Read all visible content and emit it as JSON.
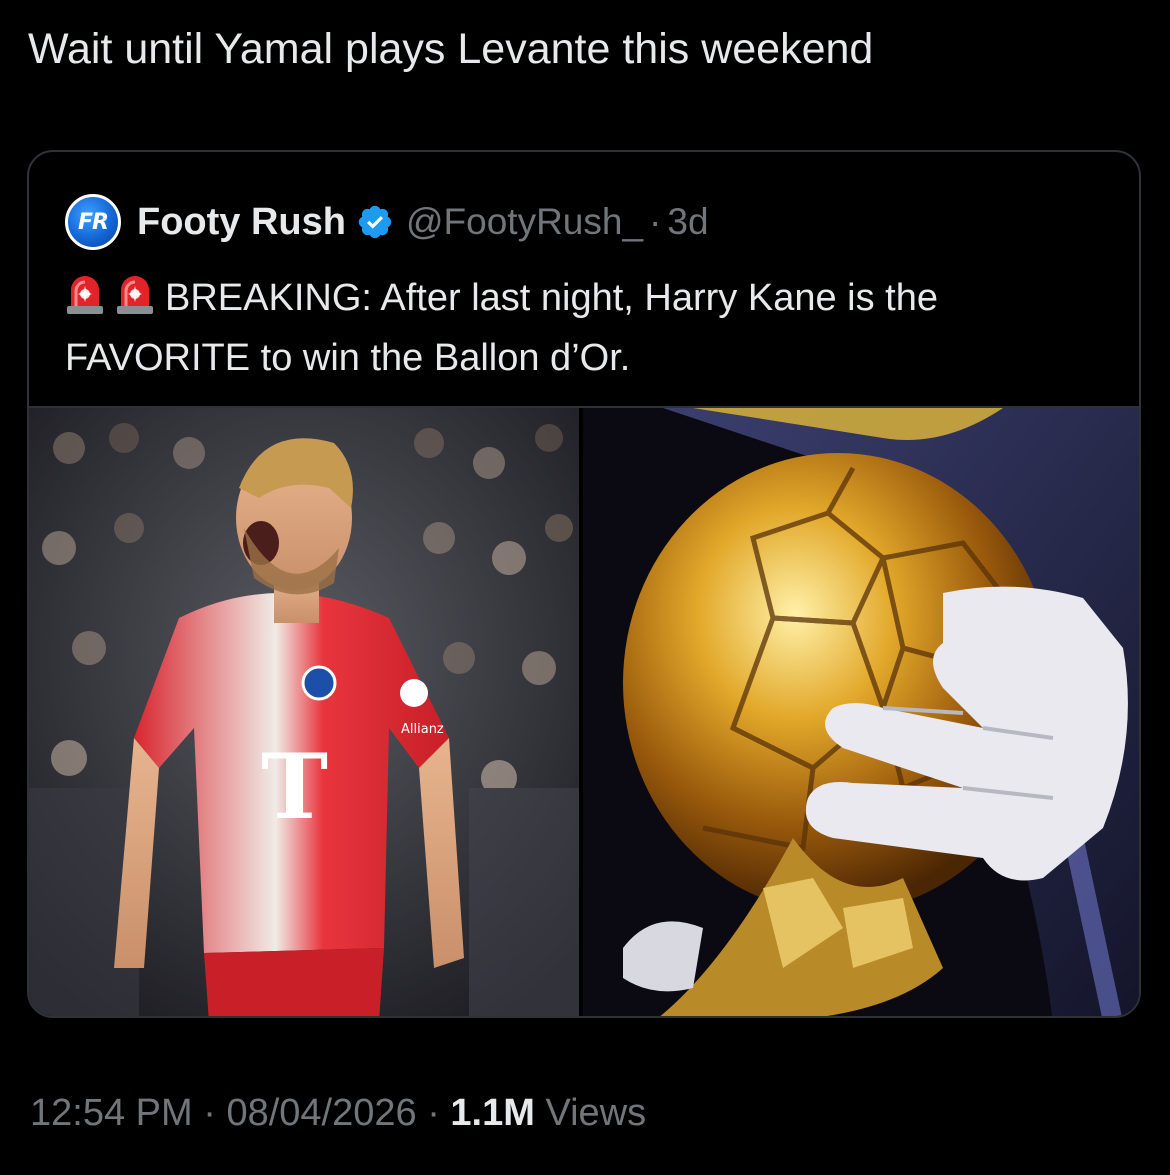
{
  "tweet": {
    "text": "Wait until Yamal plays Levante this weekend"
  },
  "quoted_tweet": {
    "avatar_text": "FR",
    "display_name": "Footy Rush",
    "handle": "@FootyRush_",
    "separator": "·",
    "age": "3d",
    "body": "BREAKING: After last night, Harry Kane is the FAVORITE to win the Ballon d’Or.",
    "icons": [
      "siren-icon",
      "siren-icon"
    ],
    "jersey_sponsor": "T",
    "jersey_partner": "Allianz"
  },
  "footer": {
    "time": "12:54 PM",
    "separator": "·",
    "date": "08/04/2026",
    "views_count": "1.1M",
    "views_label": "Views"
  },
  "colors": {
    "background": "#000000",
    "text_primary": "#e7e9ea",
    "text_secondary": "#71767b",
    "border": "#2f3336",
    "verified": "#1d9bf0"
  }
}
